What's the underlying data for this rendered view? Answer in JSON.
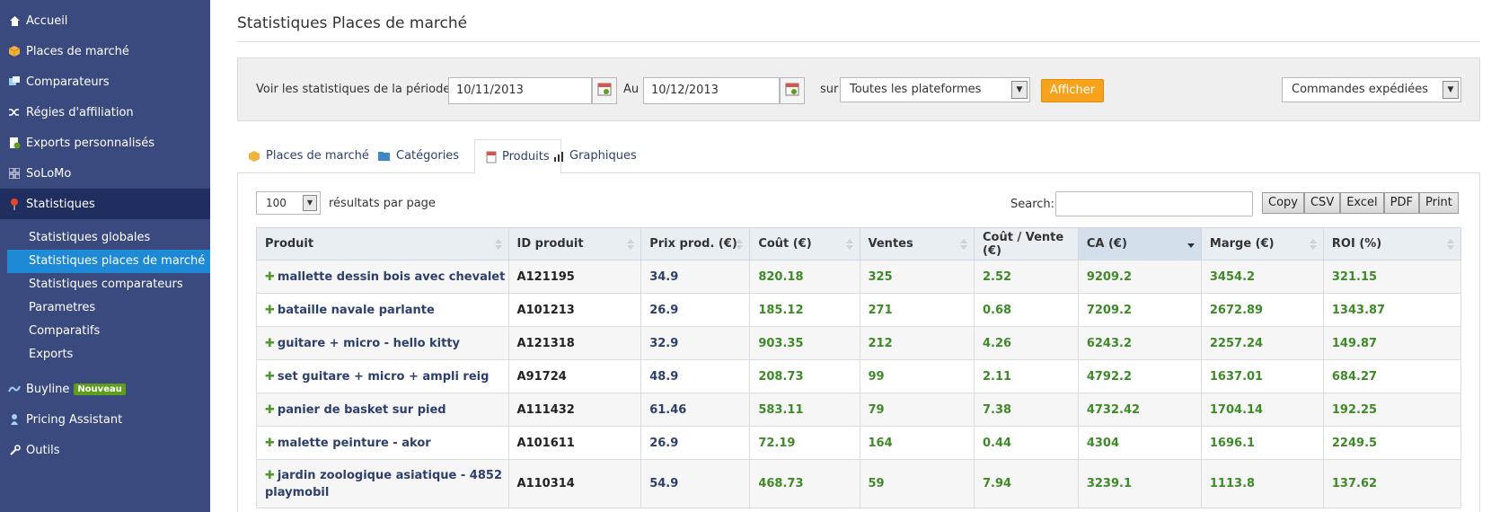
{
  "sidebar": {
    "items": [
      {
        "label": "Accueil",
        "icon": "home-icon"
      },
      {
        "label": "Places de marché",
        "icon": "box-icon"
      },
      {
        "label": "Comparateurs",
        "icon": "compare-icon"
      },
      {
        "label": "Régies d'affiliation",
        "icon": "shuffle-icon"
      },
      {
        "label": "Exports personnalisés",
        "icon": "export-icon"
      },
      {
        "label": "SoLoMo",
        "icon": "grid-icon"
      },
      {
        "label": "Statistiques",
        "icon": "pin-icon"
      }
    ],
    "sub_items": [
      "Statistiques globales",
      "Statistiques places de marché",
      "Statistiques comparateurs",
      "Parametres",
      "Comparatifs",
      "Exports"
    ],
    "bottom_items": [
      {
        "label": "Buyline",
        "badge": "Nouveau",
        "icon": "buyline-icon"
      },
      {
        "label": "Pricing Assistant",
        "icon": "pricing-icon"
      },
      {
        "label": "Outils",
        "icon": "wrench-icon"
      }
    ]
  },
  "header": {
    "title": "Statistiques Places de marché"
  },
  "filter": {
    "period_label": "Voir les statistiques de la période du",
    "from_date": "10/11/2013",
    "to_label": "Au",
    "to_date": "10/12/2013",
    "on_label": "sur",
    "platform": "Toutes les plateformes",
    "submit": "Afficher",
    "order_status": "Commandes expédiées"
  },
  "tabs": [
    "Places de marché",
    "Catégories",
    "Produits",
    "Graphiques"
  ],
  "table_controls": {
    "per_page": "100",
    "per_page_label": "résultats par page",
    "search_label": "Search:",
    "export_buttons": [
      "Copy",
      "CSV",
      "Excel",
      "PDF",
      "Print"
    ]
  },
  "table": {
    "headers": [
      "Produit",
      "ID produit",
      "Prix prod. (€)",
      "Coût (€)",
      "Ventes",
      "Coût / Vente (€)",
      "CA (€)",
      "Marge (€)",
      "ROI (%)"
    ],
    "rows": [
      [
        "mallette dessin bois avec chevalet",
        "A121195",
        "34.9",
        "820.18",
        "325",
        "2.52",
        "9209.2",
        "3454.2",
        "321.15"
      ],
      [
        "bataille navale parlante",
        "A101213",
        "26.9",
        "185.12",
        "271",
        "0.68",
        "7209.2",
        "2672.89",
        "1343.87"
      ],
      [
        "guitare + micro - hello kitty",
        "A121318",
        "32.9",
        "903.35",
        "212",
        "4.26",
        "6243.2",
        "2257.24",
        "149.87"
      ],
      [
        "set guitare + micro + ampli reig",
        "A91724",
        "48.9",
        "208.73",
        "99",
        "2.11",
        "4792.2",
        "1637.01",
        "684.27"
      ],
      [
        "panier de basket sur pied",
        "A111432",
        "61.46",
        "583.11",
        "79",
        "7.38",
        "4732.42",
        "1704.14",
        "192.25"
      ],
      [
        "malette peinture - akor",
        "A101611",
        "26.9",
        "72.19",
        "164",
        "0.44",
        "4304",
        "1696.1",
        "2249.5"
      ],
      [
        "jardin zoologique asiatique - 4852 playmobil",
        "A110314",
        "54.9",
        "468.73",
        "59",
        "7.94",
        "3239.1",
        "1113.8",
        "137.62"
      ]
    ]
  }
}
